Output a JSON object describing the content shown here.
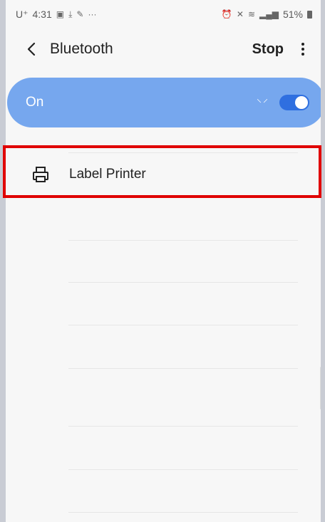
{
  "status_bar": {
    "carrier": "U⁺",
    "time": "4:31",
    "left_icons": [
      "image-icon",
      "download-icon",
      "pen-icon",
      "more-dots-icon"
    ],
    "right_icons": [
      "alarm-icon",
      "mute-icon",
      "lte-icon",
      "signal-icon"
    ],
    "battery": "51%"
  },
  "header": {
    "title": "Bluetooth",
    "stop_label": "Stop"
  },
  "toggle": {
    "label": "On",
    "state": "on",
    "switch_color": "#2f6fe0",
    "bar_color": "#76a7ee"
  },
  "devices": [
    {
      "name": "Label Printer",
      "icon": "printer-icon"
    }
  ],
  "highlight": {
    "color": "#e00000"
  }
}
